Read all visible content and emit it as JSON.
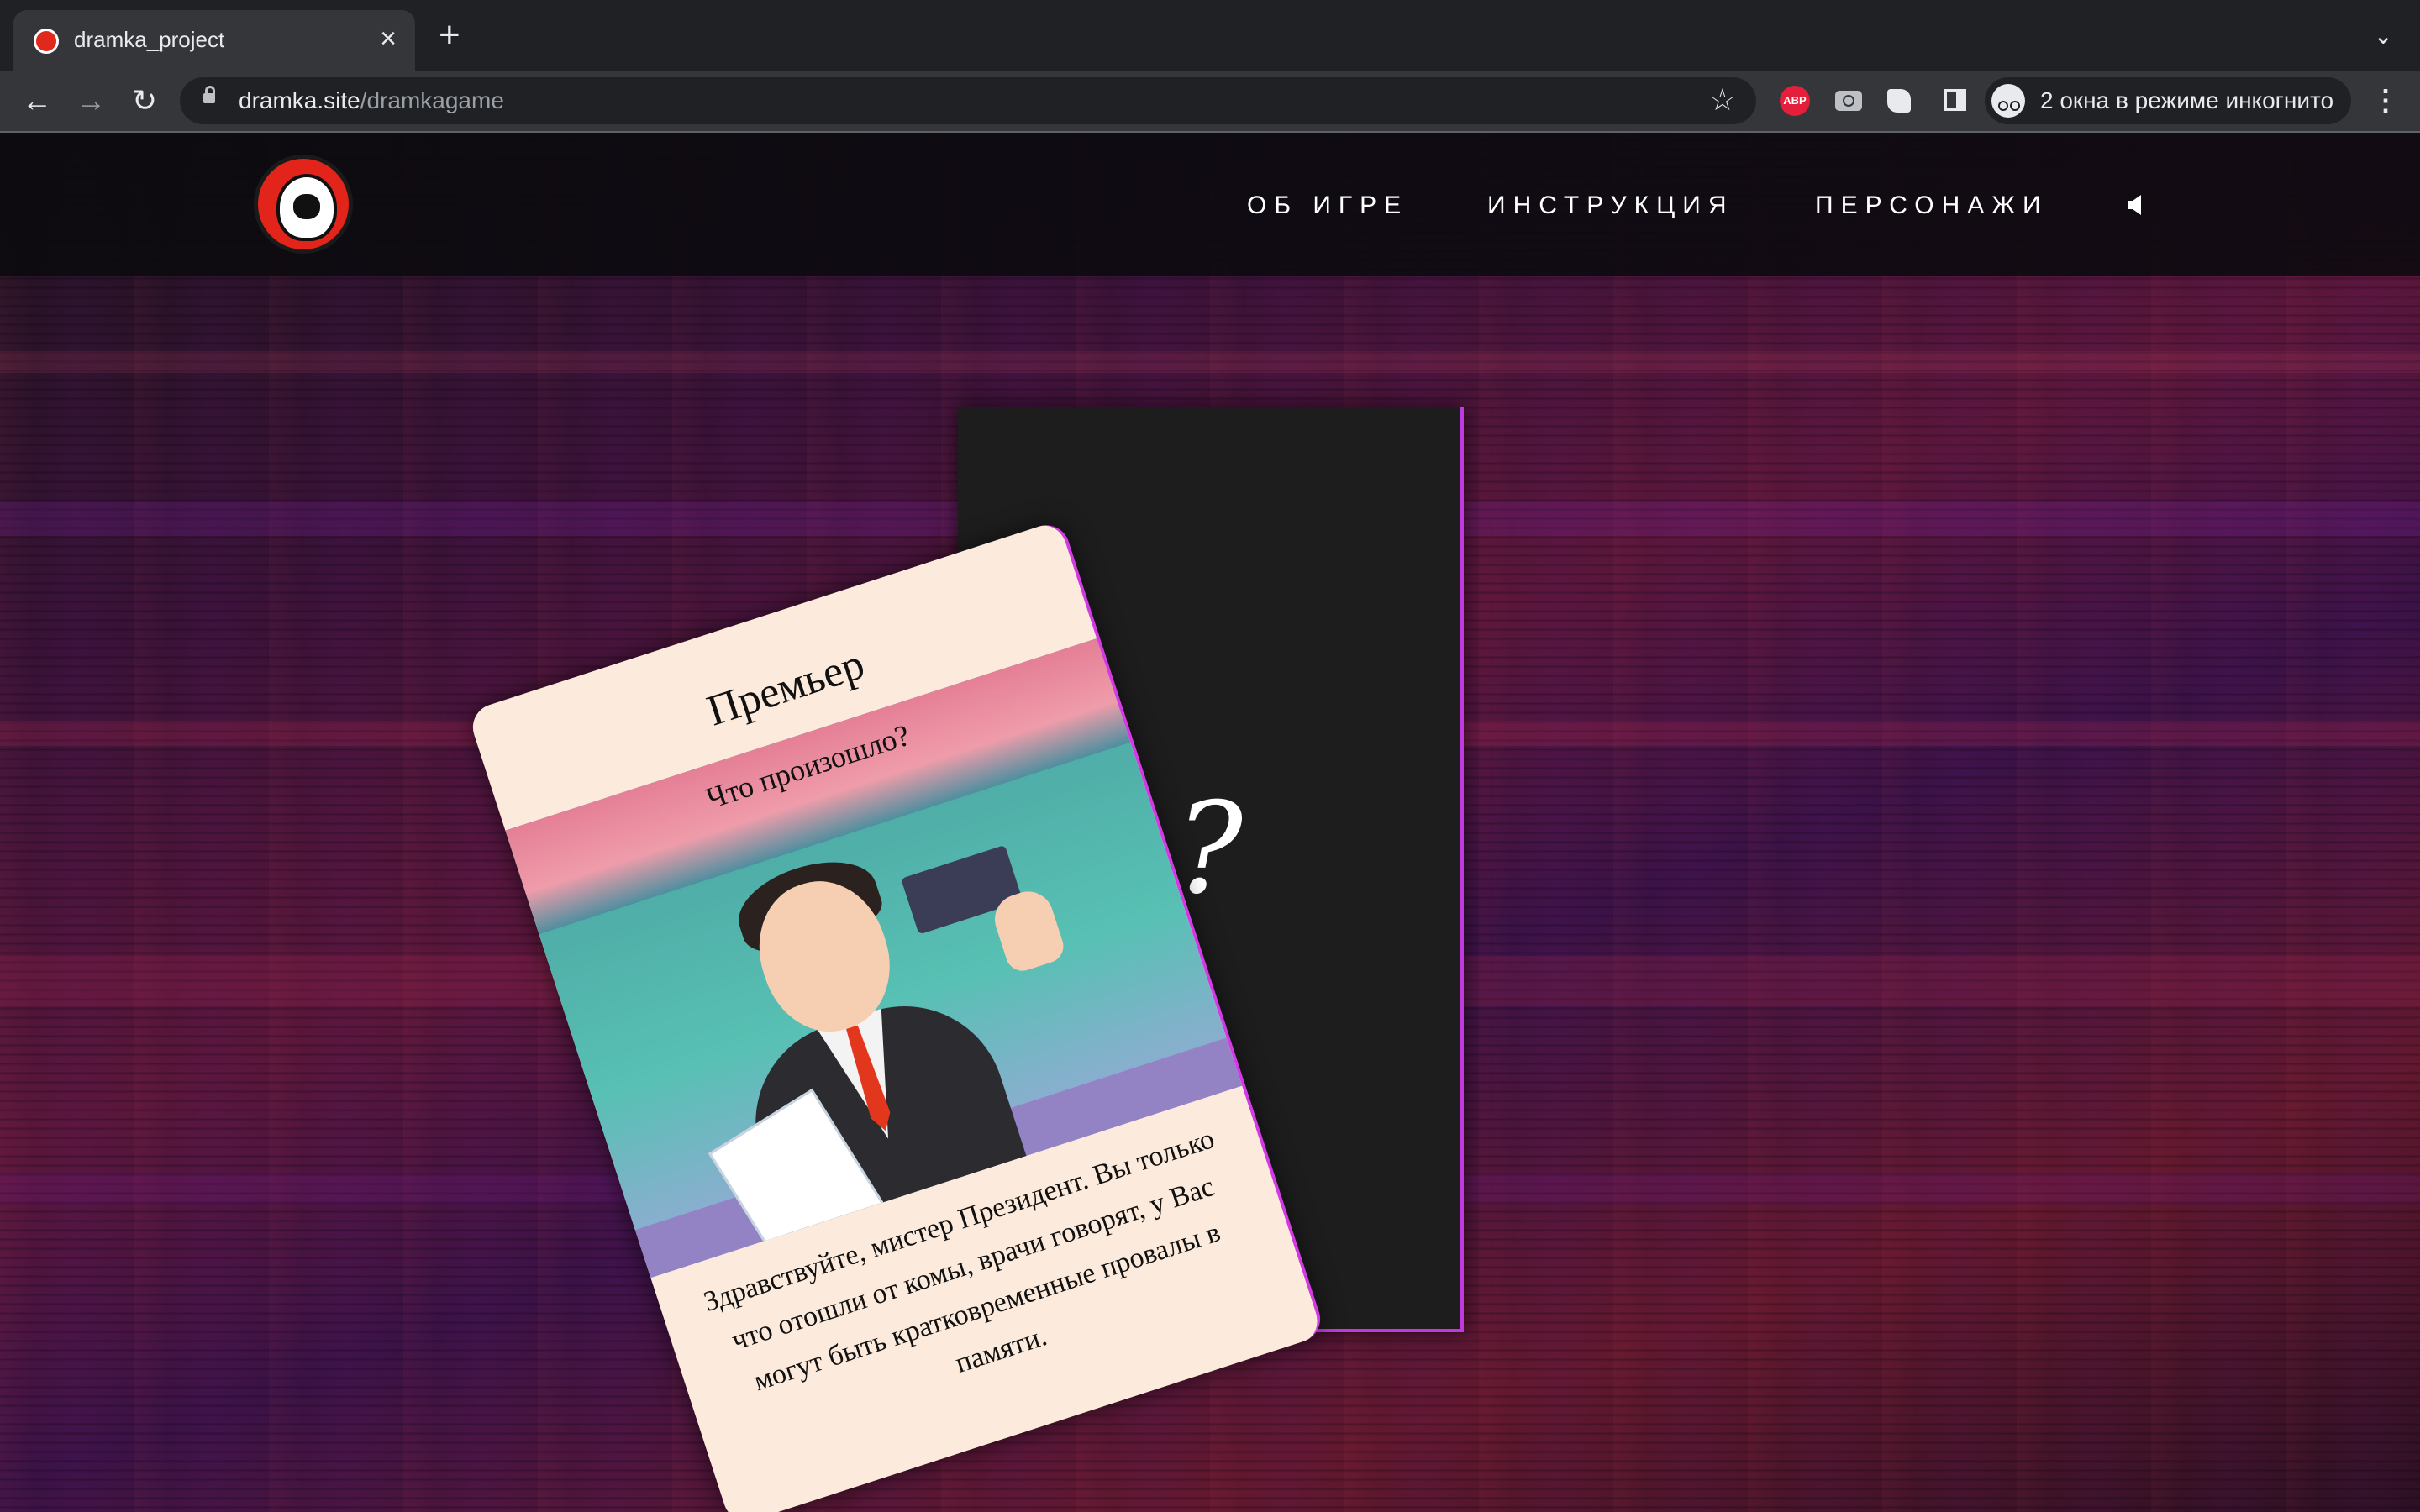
{
  "browser": {
    "tab_title": "dramka_project",
    "url_host": "dramka.site",
    "url_path": "/dramkagame",
    "abp_label": "ABP",
    "incognito_label": "2 окна в режиме инкогнито"
  },
  "site": {
    "nav": [
      {
        "label": "ОБ ИГРЕ"
      },
      {
        "label": "ИНСТРУКЦИЯ"
      },
      {
        "label": "ПЕРСОНАЖИ"
      }
    ]
  },
  "card_front": {
    "title": "Премьер",
    "subtitle": "Что произошло?",
    "text": "Здравствуйте, мистер Президент. Вы только что отошли от комы, врачи говорят, у Вас могут быть кратковременные провалы в памяти."
  },
  "card_back": {
    "symbol": "?"
  },
  "colors": {
    "accent": "#c03ae0",
    "logo_red": "#e3241a",
    "card_bg": "#fcebdc"
  }
}
